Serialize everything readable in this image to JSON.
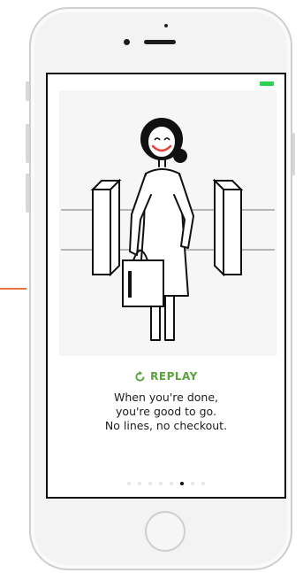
{
  "replay": {
    "label": "REPLAY",
    "icon": "replay-icon",
    "color": "#5aa33b"
  },
  "message": {
    "lines": [
      "When you're done,",
      "you're good to go.",
      "No lines, no checkout."
    ]
  },
  "pagination": {
    "total": 8,
    "active_index": 5
  },
  "illustration": {
    "description_icons": [
      "person-icon",
      "turnstile-icon",
      "shopping-bag-icon"
    ]
  },
  "colors": {
    "accent_green": "#5aa33b",
    "battery_green": "#2bd14f",
    "smile_red": "#e8433a",
    "orange_marker": "#e8743b"
  }
}
